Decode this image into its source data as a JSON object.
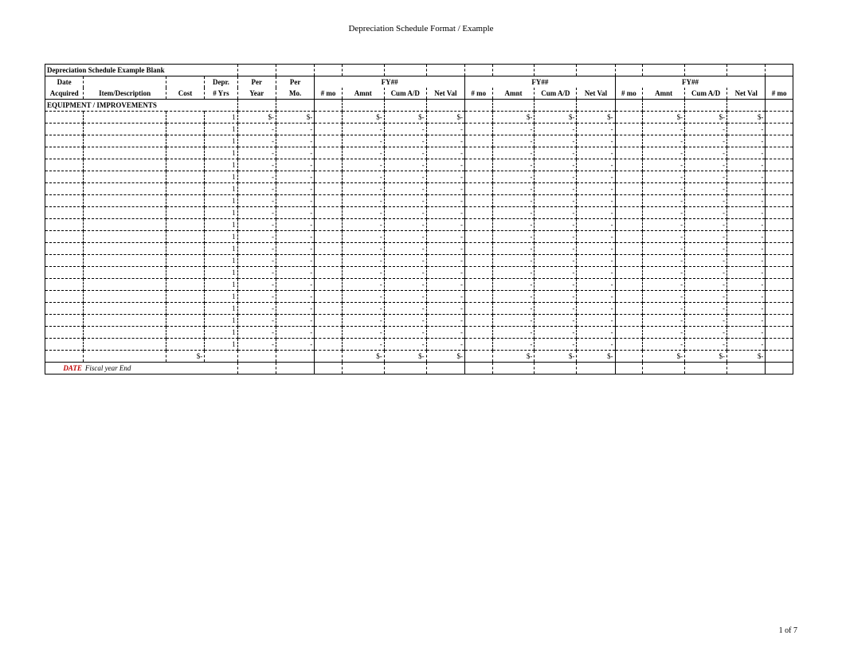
{
  "doc": {
    "title": "Depreciation Schedule Format / Example",
    "page_label": "1 of 7"
  },
  "header": {
    "sheet_title": "Depreciation Schedule Example Blank",
    "row1": {
      "date": "Date",
      "depr": "Depr.",
      "per1": "Per",
      "per2": "Per",
      "fy": "FY##"
    },
    "row2": {
      "acquired": "Acquired",
      "item": "Item/Description",
      "cost": "Cost",
      "yrs": "# Yrs",
      "year": "Year",
      "mo": "Mo.",
      "nmo": "# mo",
      "amnt": "Amnt",
      "cum": "Cum A/D",
      "net": "Net Val"
    }
  },
  "section": {
    "equipment": "EQUIPMENT / IMPROVEMENTS"
  },
  "vals": {
    "one": "1",
    "dolldash": "$-",
    "dash": "-"
  },
  "footer": {
    "date_word": "DATE",
    "label": "Fiscal year End"
  },
  "counts": {
    "dollar_rows": 1,
    "dash_rows": 19
  }
}
